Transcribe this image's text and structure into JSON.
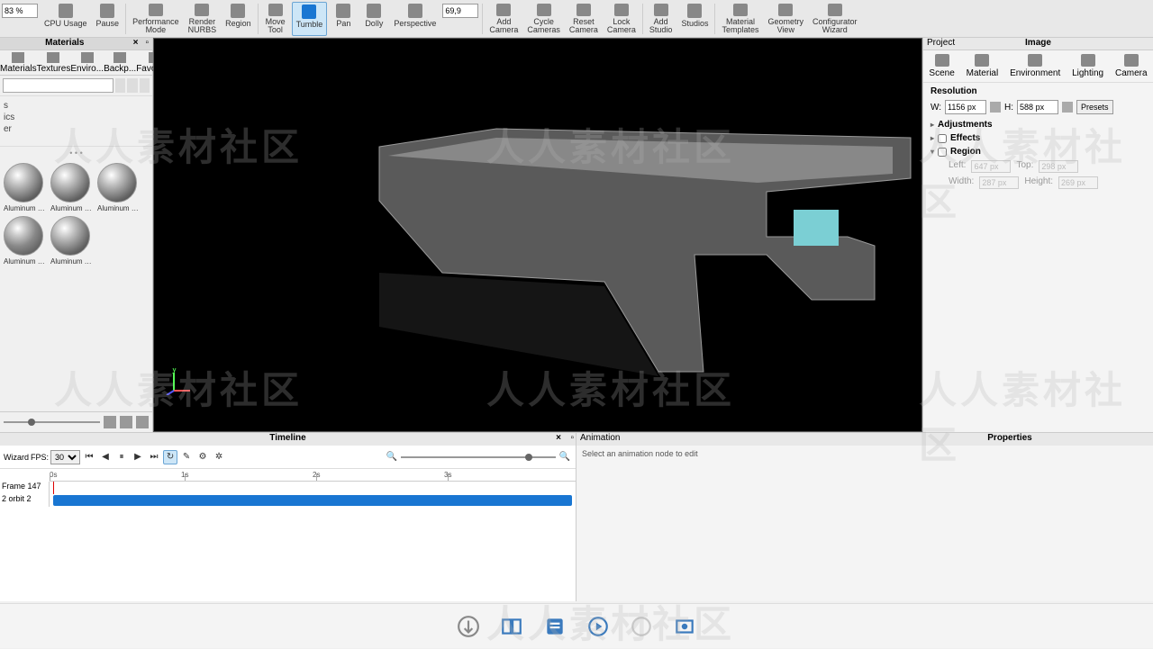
{
  "toolbar": {
    "zoom": "83 %",
    "coord": "69,9",
    "buttons": [
      {
        "label": "CPU Usage",
        "name": "cpu-usage"
      },
      {
        "label": "Pause",
        "name": "pause"
      },
      {
        "label": "Performance\nMode",
        "name": "performance-mode"
      },
      {
        "label": "Render\nNURBS",
        "name": "render-nurbs"
      },
      {
        "label": "Region",
        "name": "region"
      },
      {
        "label": "Move\nTool",
        "name": "move-tool"
      },
      {
        "label": "Tumble",
        "name": "tumble",
        "active": true
      },
      {
        "label": "Pan",
        "name": "pan"
      },
      {
        "label": "Dolly",
        "name": "dolly"
      },
      {
        "label": "Perspective",
        "name": "perspective"
      },
      {
        "label": "Add\nCamera",
        "name": "add-camera"
      },
      {
        "label": "Cycle\nCameras",
        "name": "cycle-cameras"
      },
      {
        "label": "Reset\nCamera",
        "name": "reset-camera"
      },
      {
        "label": "Lock\nCamera",
        "name": "lock-camera"
      },
      {
        "label": "Add\nStudio",
        "name": "add-studio"
      },
      {
        "label": "Studios",
        "name": "studios"
      },
      {
        "label": "Material\nTemplates",
        "name": "material-templates"
      },
      {
        "label": "Geometry\nView",
        "name": "geometry-view"
      },
      {
        "label": "Configurator\nWizard",
        "name": "configurator-wizard"
      }
    ]
  },
  "materials": {
    "title": "Materials",
    "tabs": [
      "Materials",
      "Textures",
      "Enviro...",
      "Backp...",
      "Favorites"
    ],
    "search_placeholder": "",
    "tree": [
      "s",
      "ics",
      "er"
    ],
    "dots": "• • •",
    "items": [
      {
        "label": "Aluminum B..."
      },
      {
        "label": "Aluminum P..."
      },
      {
        "label": "Aluminum R..."
      },
      {
        "label": "Aluminum R..."
      },
      {
        "label": "Aluminum T..."
      }
    ]
  },
  "project": {
    "left_tab": "Project",
    "center_tab": "Image",
    "tabs": [
      "Scene",
      "Material",
      "Environment",
      "Lighting",
      "Camera"
    ],
    "resolution": {
      "title": "Resolution",
      "w_label": "W:",
      "w_value": "1156 px",
      "h_label": "H:",
      "h_value": "588 px",
      "presets_label": "Presets"
    },
    "adjustments": {
      "title": "Adjustments"
    },
    "effects": {
      "title": "Effects"
    },
    "region": {
      "title": "Region",
      "left_label": "Left:",
      "left_value": "647 px",
      "top_label": "Top:",
      "top_value": "298 px",
      "width_label": "Width:",
      "width_value": "287 px",
      "height_label": "Height:",
      "height_value": "269 px"
    }
  },
  "timeline": {
    "title": "Timeline",
    "wizard_label": "Wizard",
    "fps_label": "FPS:",
    "fps_value": "30",
    "frame_label": "Frame 147",
    "track_label": "2 orbit 2",
    "ticks": [
      "0s",
      "1s",
      "2s",
      "3s"
    ]
  },
  "animation": {
    "left_tab": "Animation",
    "right_tab": "Properties",
    "message": "Select an animation node to edit"
  },
  "watermark": "人人素材社区"
}
